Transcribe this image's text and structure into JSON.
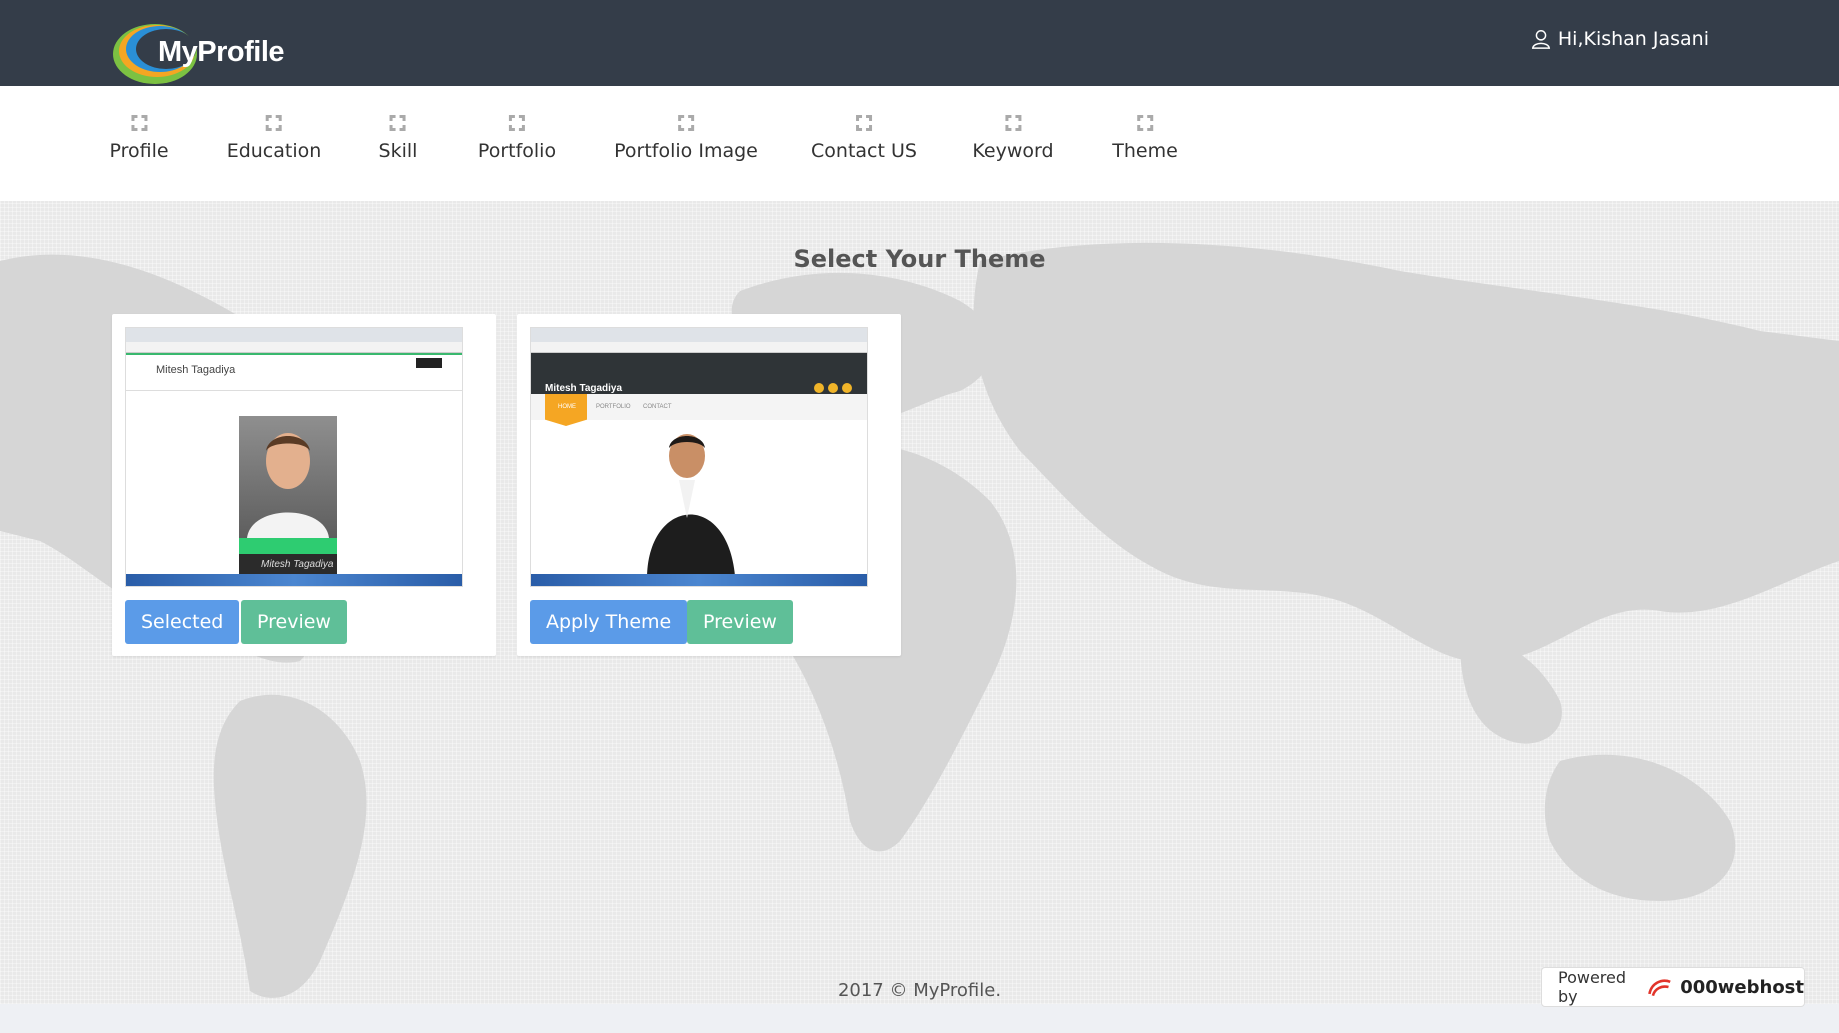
{
  "header": {
    "logo_text": "MyProfile",
    "user_greeting": "Hi,Kishan Jasani"
  },
  "nav": {
    "items": [
      {
        "label": "Profile"
      },
      {
        "label": "Education"
      },
      {
        "label": "Skill"
      },
      {
        "label": "Portfolio"
      },
      {
        "label": "Portfolio Image"
      },
      {
        "label": "Contact US"
      },
      {
        "label": "Keyword"
      },
      {
        "label": "Theme"
      }
    ]
  },
  "main": {
    "title": "Select Your Theme",
    "themes": [
      {
        "thumb_name": "Mitesh Tagadiya",
        "thumb_signature": "Mitesh Tagadiya",
        "primary_button": "Selected",
        "preview_button": "Preview"
      },
      {
        "thumb_name": "Mitesh Tagadiya",
        "thumb_menu": [
          "HOME",
          "PORTFOLIO",
          "CONTACT"
        ],
        "primary_button": "Apply Theme",
        "preview_button": "Preview"
      }
    ]
  },
  "footer": {
    "copyright": "2017 © MyProfile.",
    "powered_label": "Powered by",
    "powered_brand": "000webhost"
  },
  "colors": {
    "header_bg": "#343d49",
    "button_blue": "#5b9be8",
    "button_green": "#5fbf98"
  }
}
